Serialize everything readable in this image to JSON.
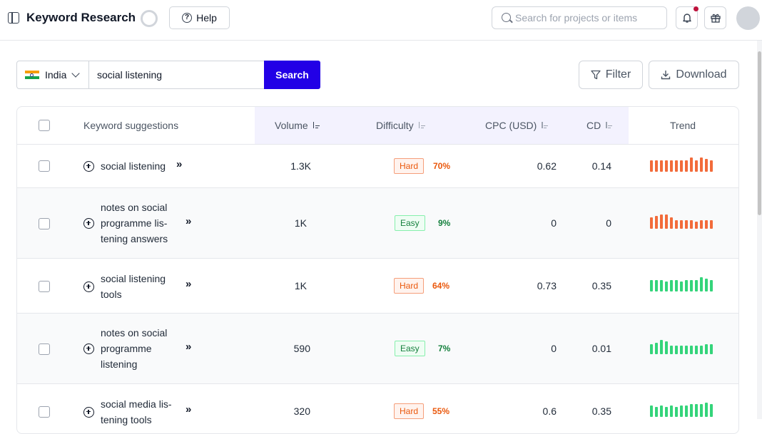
{
  "header": {
    "title": "Keyword Research",
    "help_label": "Help",
    "search_placeholder": "Search for projects or items"
  },
  "search": {
    "country": "India",
    "keyword": "social listening",
    "search_label": "Search",
    "filter_label": "Filter",
    "download_label": "Download"
  },
  "table": {
    "columns": {
      "keyword": "Keyword suggestions",
      "volume": "Volume",
      "difficulty": "Difficulty",
      "cpc": "CPC (USD)",
      "cd": "CD",
      "trend": "Trend"
    },
    "rows": [
      {
        "keyword": "social listening",
        "volume": "1.3K",
        "difficulty_label": "Hard",
        "difficulty_pct": "70%",
        "cpc": "0.62",
        "cd": "0.14",
        "trend": [
          0.8,
          0.8,
          0.8,
          0.8,
          0.8,
          0.8,
          0.8,
          0.8,
          1.0,
          0.8,
          1.0,
          0.9,
          0.8
        ]
      },
      {
        "keyword": "notes on social programme lis-tening answers",
        "volume": "1K",
        "difficulty_label": "Easy",
        "difficulty_pct": "9%",
        "cpc": "0",
        "cd": "0",
        "trend": [
          0.8,
          0.9,
          1.0,
          1.0,
          0.8,
          0.6,
          0.6,
          0.6,
          0.6,
          0.5,
          0.6,
          0.6,
          0.6
        ]
      },
      {
        "keyword": "social listening tools",
        "volume": "1K",
        "difficulty_label": "Hard",
        "difficulty_pct": "64%",
        "cpc": "0.73",
        "cd": "0.35",
        "trend": [
          0.8,
          0.8,
          0.8,
          0.7,
          0.8,
          0.8,
          0.7,
          0.8,
          0.8,
          0.8,
          1.0,
          0.9,
          0.8
        ]
      },
      {
        "keyword": "notes on social programme listening",
        "volume": "590",
        "difficulty_label": "Easy",
        "difficulty_pct": "7%",
        "cpc": "0",
        "cd": "0.01",
        "trend": [
          0.7,
          0.8,
          1.0,
          0.9,
          0.6,
          0.6,
          0.6,
          0.6,
          0.6,
          0.6,
          0.6,
          0.7,
          0.7
        ]
      },
      {
        "keyword": "social media lis-tening tools",
        "volume": "320",
        "difficulty_label": "Hard",
        "difficulty_pct": "55%",
        "cpc": "0.6",
        "cd": "0.35",
        "trend": [
          0.8,
          0.7,
          0.8,
          0.7,
          0.8,
          0.7,
          0.8,
          0.8,
          0.9,
          0.9,
          0.9,
          1.0,
          0.9
        ]
      }
    ]
  },
  "colors": {
    "accent": "#2200e6",
    "hard": "#ea580c",
    "hard_trend": "#f26b3a",
    "easy": "#15803d",
    "easy_trend": "#34d47a"
  }
}
